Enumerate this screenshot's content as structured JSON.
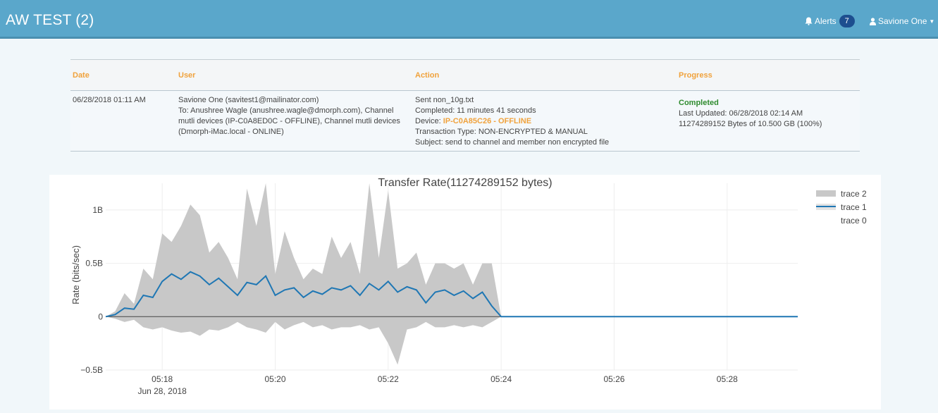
{
  "header": {
    "title": "AW TEST (2)",
    "alerts_label": "Alerts",
    "alerts_count": "7",
    "user_name": "Savione One"
  },
  "table": {
    "columns": [
      "Date",
      "User",
      "Action",
      "Progress"
    ],
    "row": {
      "date": "06/28/2018 01:11 AM",
      "user_lines": [
        "Savione One (savitest1@mailinator.com)",
        "To: Anushree Wagle (anushree.wagle@dmorph.com), Channel",
        "mutli devices (IP-C0A8ED0C - OFFLINE), Channel mutli devices",
        "(Dmorph-iMac.local - ONLINE)"
      ],
      "action_sent": "Sent non_10g.txt",
      "action_completed": "Completed: 11 minutes 41 seconds",
      "action_device_label": "Device: ",
      "action_device_value": "IP-C0A85C26 - OFFLINE",
      "action_transaction": "Transaction Type: NON-ENCRYPTED & MANUAL",
      "action_subject": "Subject: send to channel and member non encrypted file",
      "progress_status": "Completed",
      "progress_updated": "Last Updated: 06/28/2018 02:14 AM",
      "progress_bytes": "11274289152 Bytes of 10.500 GB (100%)"
    }
  },
  "colors": {
    "header_bg": "#5aa7cb",
    "accent_orange": "#f0a23c",
    "completed_green": "#2e8b2e",
    "trace_fill": "#c8c8c8",
    "trace_line": "#1f77b4"
  },
  "chart_data": {
    "type": "area",
    "title": "Transfer Rate(11274289152 bytes)",
    "ylabel": "Rate (bits/sec)",
    "xlabel": "",
    "ylim": [
      -0.5,
      1.25
    ],
    "y_unit": "billion bits/sec",
    "yticks": [
      {
        "value": 1,
        "label": "1B"
      },
      {
        "value": 0.5,
        "label": "0.5B"
      },
      {
        "value": 0,
        "label": "0"
      },
      {
        "value": -0.5,
        "label": "−0.5B"
      }
    ],
    "xlim": [
      "05:17:00",
      "05:29:15"
    ],
    "xticks": [
      {
        "value": "05:18:00",
        "label": "05:18",
        "sublabel": "Jun 28, 2018"
      },
      {
        "value": "05:20:00",
        "label": "05:20"
      },
      {
        "value": "05:22:00",
        "label": "05:22"
      },
      {
        "value": "05:24:00",
        "label": "05:24"
      },
      {
        "value": "05:26:00",
        "label": "05:26"
      },
      {
        "value": "05:28:00",
        "label": "05:28"
      }
    ],
    "grid": true,
    "legend_position": "top-right",
    "legend": [
      "trace 2",
      "trace 1",
      "trace 0"
    ],
    "series": [
      {
        "name": "trace 1",
        "x": [
          "05:17:00",
          "05:17:10",
          "05:17:20",
          "05:17:30",
          "05:17:40",
          "05:17:50",
          "05:18:00",
          "05:18:10",
          "05:18:20",
          "05:18:30",
          "05:18:40",
          "05:18:50",
          "05:19:00",
          "05:19:10",
          "05:19:20",
          "05:19:30",
          "05:19:40",
          "05:19:50",
          "05:20:00",
          "05:20:10",
          "05:20:20",
          "05:20:30",
          "05:20:40",
          "05:20:50",
          "05:21:00",
          "05:21:10",
          "05:21:20",
          "05:21:30",
          "05:21:40",
          "05:21:50",
          "05:22:00",
          "05:22:10",
          "05:22:20",
          "05:22:30",
          "05:22:40",
          "05:22:50",
          "05:23:00",
          "05:23:10",
          "05:23:20",
          "05:23:30",
          "05:23:40",
          "05:23:50",
          "05:24:00",
          "05:25:00",
          "05:26:00",
          "05:27:00",
          "05:28:00",
          "05:29:00",
          "05:29:15"
        ],
        "values": [
          0,
          0.02,
          0.08,
          0.07,
          0.2,
          0.18,
          0.33,
          0.4,
          0.35,
          0.42,
          0.38,
          0.3,
          0.36,
          0.28,
          0.2,
          0.32,
          0.3,
          0.38,
          0.2,
          0.25,
          0.27,
          0.18,
          0.24,
          0.21,
          0.27,
          0.25,
          0.29,
          0.2,
          0.31,
          0.25,
          0.33,
          0.23,
          0.28,
          0.25,
          0.13,
          0.23,
          0.25,
          0.2,
          0.24,
          0.17,
          0.23,
          0.1,
          0,
          0,
          0,
          0,
          0,
          0,
          0
        ]
      },
      {
        "name": "trace 2",
        "x": [
          "05:17:00",
          "05:17:10",
          "05:17:20",
          "05:17:30",
          "05:17:40",
          "05:17:50",
          "05:18:00",
          "05:18:10",
          "05:18:20",
          "05:18:30",
          "05:18:40",
          "05:18:50",
          "05:19:00",
          "05:19:10",
          "05:19:20",
          "05:19:30",
          "05:19:40",
          "05:19:50",
          "05:20:00",
          "05:20:10",
          "05:20:20",
          "05:20:30",
          "05:20:40",
          "05:20:50",
          "05:21:00",
          "05:21:10",
          "05:21:20",
          "05:21:30",
          "05:21:40",
          "05:21:50",
          "05:22:00",
          "05:22:10",
          "05:22:20",
          "05:22:30",
          "05:22:40",
          "05:22:50",
          "05:23:00",
          "05:23:10",
          "05:23:20",
          "05:23:30",
          "05:23:40",
          "05:23:50",
          "05:24:00"
        ],
        "upper": [
          0,
          0.05,
          0.22,
          0.12,
          0.45,
          0.35,
          0.78,
          0.7,
          0.85,
          1.05,
          0.95,
          0.6,
          0.7,
          0.55,
          0.35,
          1.2,
          0.85,
          1.25,
          0.4,
          0.8,
          0.55,
          0.35,
          0.45,
          0.4,
          0.75,
          0.55,
          0.7,
          0.4,
          1.25,
          0.55,
          1.18,
          0.45,
          0.5,
          0.6,
          0.3,
          0.5,
          0.5,
          0.45,
          0.5,
          0.3,
          0.5,
          0.5,
          0
        ],
        "lower": [
          0,
          -0.02,
          -0.05,
          -0.03,
          -0.1,
          -0.12,
          -0.1,
          -0.13,
          -0.15,
          -0.14,
          -0.18,
          -0.12,
          -0.13,
          -0.1,
          -0.05,
          -0.1,
          -0.12,
          -0.15,
          -0.05,
          -0.12,
          -0.08,
          -0.05,
          -0.1,
          -0.08,
          -0.12,
          -0.1,
          -0.1,
          -0.08,
          -0.12,
          -0.1,
          -0.25,
          -0.45,
          -0.12,
          -0.1,
          -0.05,
          -0.1,
          -0.1,
          -0.08,
          -0.1,
          -0.08,
          -0.1,
          -0.05,
          0
        ]
      },
      {
        "name": "trace 0",
        "x": [
          "05:17:00",
          "05:29:15"
        ],
        "values": [
          0,
          0
        ]
      }
    ]
  }
}
